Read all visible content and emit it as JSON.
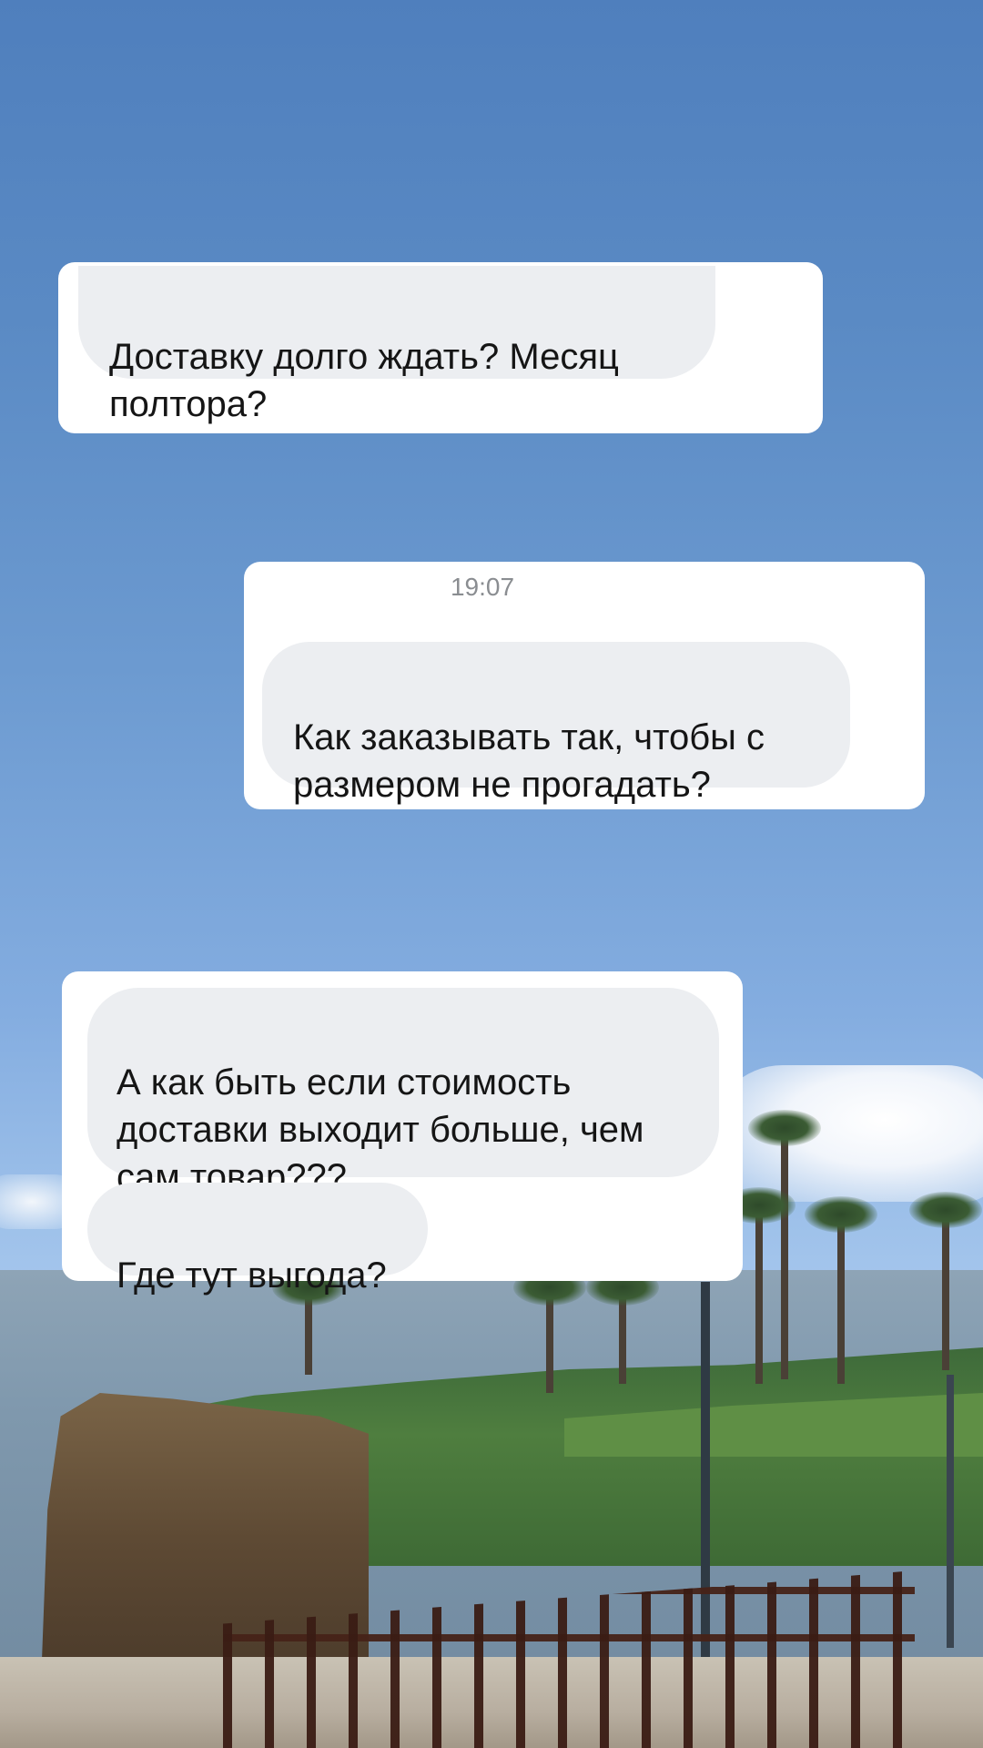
{
  "messages": [
    {
      "text": "Доставку долго ждать? Месяц\nполтора?"
    },
    {
      "time": "19:07",
      "text": "Как заказывать так, чтобы с\nразмером не прогадать?"
    },
    {
      "text": "А как быть если стоимость\nдоставки выходит больше, чем\nсам товар???"
    },
    {
      "text": "Где тут выгода?"
    }
  ],
  "colors": {
    "card": "#ffffff",
    "bubble": "#eceef1",
    "text": "#151515",
    "timestamp": "#8a8d91"
  }
}
